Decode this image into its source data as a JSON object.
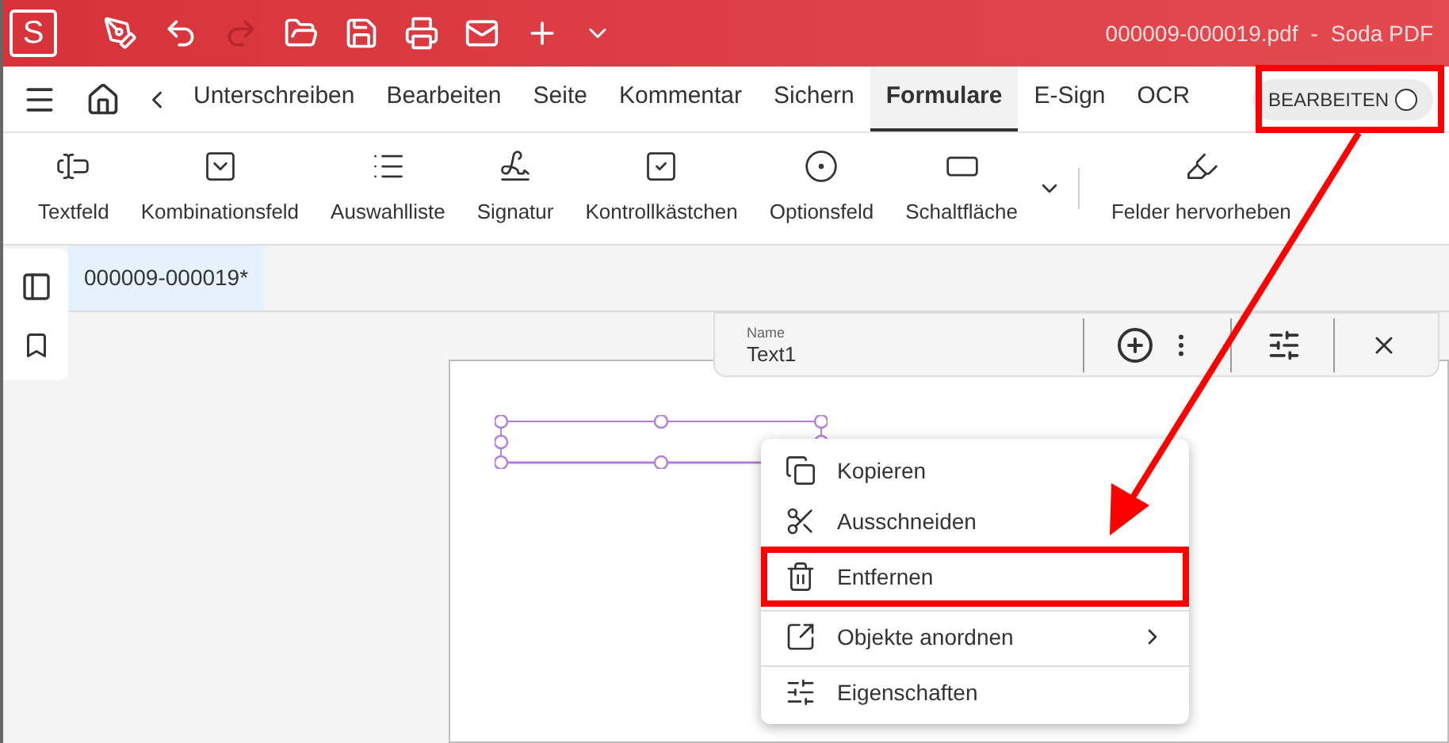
{
  "title_bar": {
    "logo": "S",
    "quick_actions": [
      {
        "kind": "pen",
        "disabled": false
      },
      {
        "kind": "undo",
        "disabled": false
      },
      {
        "kind": "redo",
        "disabled": true
      },
      {
        "kind": "open",
        "disabled": false
      },
      {
        "kind": "save",
        "disabled": false
      },
      {
        "kind": "print",
        "disabled": false
      },
      {
        "kind": "mail",
        "disabled": false
      },
      {
        "kind": "plus",
        "disabled": false
      },
      {
        "kind": "more",
        "disabled": false
      }
    ],
    "file_name": "000009-000019.pdf",
    "separator": "-",
    "app_name": "Soda PDF"
  },
  "menu_tabs": [
    {
      "label": "Unterschreiben",
      "selected": false
    },
    {
      "label": "Bearbeiten",
      "selected": false
    },
    {
      "label": "Seite",
      "selected": false
    },
    {
      "label": "Kommentar",
      "selected": false
    },
    {
      "label": "Sichern",
      "selected": false
    },
    {
      "label": "Formulare",
      "selected": true
    },
    {
      "label": "E-Sign",
      "selected": false
    },
    {
      "label": "OCR",
      "selected": false
    }
  ],
  "edit_toggle": {
    "label": "BEARBEITEN",
    "on": false
  },
  "tools": [
    {
      "kind": "textfield",
      "label": "Textfeld"
    },
    {
      "kind": "combo",
      "label": "Kombinationsfeld"
    },
    {
      "kind": "list",
      "label": "Auswahlliste"
    },
    {
      "kind": "signature",
      "label": "Signatur"
    },
    {
      "kind": "checkbox",
      "label": "Kontrollkästchen"
    },
    {
      "kind": "radio",
      "label": "Optionsfeld"
    },
    {
      "kind": "button",
      "label": "Schaltfläche"
    },
    {
      "kind": "expand"
    },
    {
      "kind": "highlight",
      "label": "Felder hervorheben"
    }
  ],
  "document_tab": {
    "label": "000009-000019*",
    "selected": true
  },
  "field_bar": {
    "name_label": "Name",
    "name_value": "Text1"
  },
  "context_menu": [
    {
      "kind": "copy",
      "label": "Kopieren",
      "submenu": false,
      "separator_before": false,
      "highlighted": false
    },
    {
      "kind": "cut",
      "label": "Ausschneiden",
      "submenu": false,
      "separator_before": false,
      "highlighted": false
    },
    {
      "kind": "delete",
      "label": "Entfernen",
      "submenu": false,
      "separator_before": false,
      "highlighted": true
    },
    {
      "kind": "arrange",
      "label": "Objekte anordnen",
      "submenu": true,
      "separator_before": true,
      "highlighted": false
    },
    {
      "kind": "properties",
      "label": "Eigenschaften",
      "submenu": false,
      "separator_before": true,
      "highlighted": false
    }
  ]
}
